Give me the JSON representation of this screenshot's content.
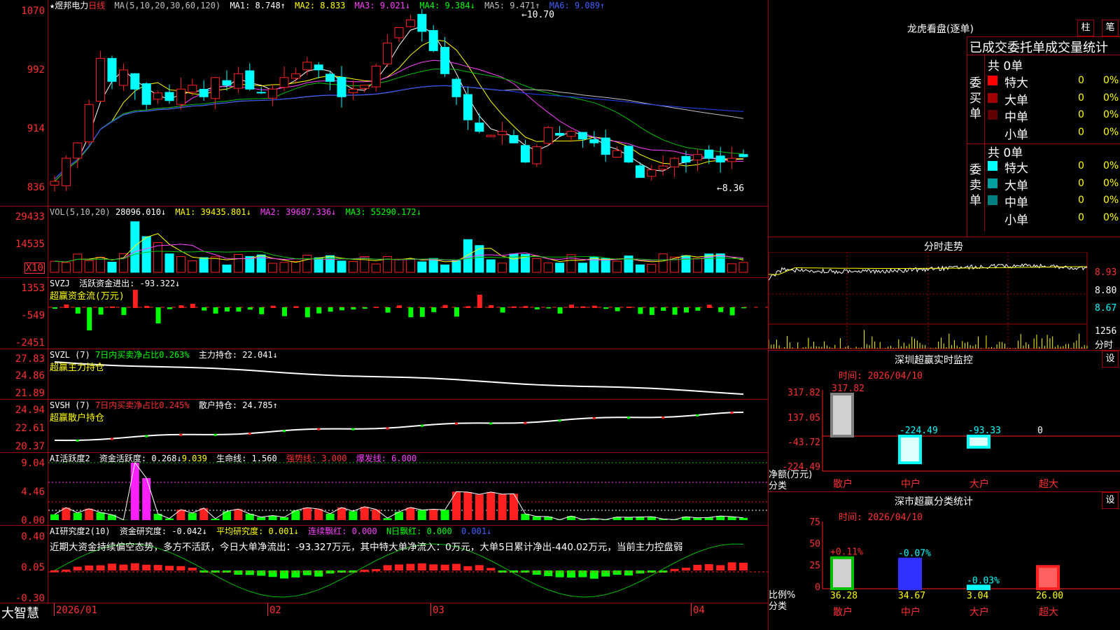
{
  "colors": {
    "up": "#ff2020",
    "down": "#00ffff",
    "ma1": "#ffffff",
    "ma2": "#ffff00",
    "ma3": "#ff40ff",
    "ma4": "#00c000",
    "ma5": "#c0c0c0",
    "ma6": "#2040ff",
    "grid": "#a00000"
  },
  "main": {
    "title": "★煜邦电力",
    "period": "日线",
    "ma_params": "MA(5,10,20,30,60,120)",
    "ma1": "MA1: 8.748↑",
    "ma2": "MA2: 8.833",
    "ma3": "MA3: 9.021↓",
    "ma4": "MA4: 9.384↓",
    "ma5": "MA5: 9.471↑",
    "ma6": "MA6: 9.089↑",
    "y_labels": [
      "1070",
      "992",
      "914",
      "836"
    ],
    "high_mark": "←10.70",
    "low_mark": "←8.36"
  },
  "vol": {
    "params": "VOL(5,10,20)",
    "vol": "28096.010↓",
    "ma1": "MA1: 39435.801↓",
    "ma2": "MA2: 39687.336↓",
    "ma3": "MA3: 55290.172↓",
    "y_labels": [
      "29433",
      "14535"
    ],
    "unit": "X10"
  },
  "svzj": {
    "name": "SVZJ",
    "label": "活跃资金进出: -93.322↓",
    "sub": "超赢资金流(万元)",
    "y_labels": [
      "1353",
      "-549",
      "-2451"
    ]
  },
  "svzl": {
    "name": "SVZL (7)",
    "ratio": "7日内买卖净占比0.263%",
    "hold": "主力持仓: 22.041↓",
    "sub": "超赢主力持仓",
    "y_labels": [
      "27.83",
      "24.86",
      "21.89"
    ]
  },
  "svsh": {
    "name": "SVSH (7)",
    "ratio": "7日内买卖净占比0.245%",
    "hold": "散户持仓: 24.785↑",
    "sub": "超赢散户持仓",
    "y_labels": [
      "24.94",
      "22.61",
      "20.37"
    ]
  },
  "ai1": {
    "name": "AI活跃度2",
    "a": "资金活跃度: 0.268↓",
    "b": "9.039",
    "c": "生命线: 1.560",
    "d": "强势线: 3.000",
    "e": "爆发线: 6.000",
    "y_labels": [
      "9.04",
      "4.46",
      "0.00"
    ]
  },
  "ai2": {
    "name": "AI研究度2(10)",
    "a": "资金研究度: -0.042↓",
    "b": "平均研究度: 0.001↓",
    "c": "连续飘红: 0.000",
    "d": "N日飘红: 0.000",
    "e": "0.001↓",
    "text": "近期大资金持续偏空态势，多方不活跃，今日大单净流出：-93.327万元，其中特大单净流入：0万元，大单5日累计净出-440.02万元，当前主力控盘弱",
    "y_labels": [
      "0.40",
      "0.05",
      "-0.30"
    ]
  },
  "xaxis": {
    "brand": "大智慧",
    "dates": [
      "2026/01",
      "02",
      "03",
      "04"
    ]
  },
  "dragon": {
    "title": "龙虎看盘(逐单)",
    "btn1": "柱",
    "btn2": "笔",
    "header": "已成交委托单成交量统计",
    "buy": {
      "side": "委买单",
      "total": "共 0单",
      "rows": [
        {
          "name": "特大",
          "v": "0",
          "p": "0%",
          "c": "#ff0000"
        },
        {
          "name": "大单",
          "v": "0",
          "p": "0%",
          "c": "#a00000"
        },
        {
          "name": "中单",
          "v": "0",
          "p": "0%",
          "c": "#600000"
        },
        {
          "name": "小单",
          "v": "0",
          "p": "0%",
          "c": "#000000"
        }
      ]
    },
    "sell": {
      "side": "委卖单",
      "total": "共 0单",
      "rows": [
        {
          "name": "特大",
          "v": "0",
          "p": "0%",
          "c": "#00ffff"
        },
        {
          "name": "大单",
          "v": "0",
          "p": "0%",
          "c": "#00a0a0"
        },
        {
          "name": "中单",
          "v": "0",
          "p": "0%",
          "c": "#008080"
        },
        {
          "name": "小单",
          "v": "0",
          "p": "0%",
          "c": "#000000"
        }
      ]
    }
  },
  "intraday": {
    "title": "分时走势",
    "y_labels": [
      "8.93",
      "8.80",
      "8.67",
      "1256",
      "分时"
    ]
  },
  "monitor": {
    "title": "深圳超赢实时监控",
    "btn": "设",
    "date": "时间: 2026/04/10",
    "y_labels": [
      "317.82",
      "137.05",
      "-43.72",
      "-224.49"
    ],
    "ylabel": "净额(万元)",
    "xlabel": "分类",
    "cats": [
      "散户",
      "中户",
      "大户",
      "超大"
    ],
    "values": [
      317.82,
      -224.49,
      -93.33,
      0
    ],
    "value_labels": [
      "317.82",
      "-224.49",
      "-93.33",
      "0"
    ]
  },
  "classify": {
    "title": "深市超赢分类统计",
    "btn": "设",
    "date": "时间: 2026/04/10",
    "y_labels": [
      "75",
      "50",
      "25",
      "0"
    ],
    "ylabel": "比例%",
    "xlabel": "分类",
    "cats": [
      "散户",
      "中户",
      "大户",
      "超大"
    ],
    "values": [
      36.28,
      34.67,
      3.04,
      26.0
    ],
    "value_labels": [
      "36.28",
      "34.67",
      "3.04",
      "26.00"
    ],
    "delta": [
      "+0.11%",
      "-0.07%",
      "-0.03%",
      ""
    ]
  }
}
